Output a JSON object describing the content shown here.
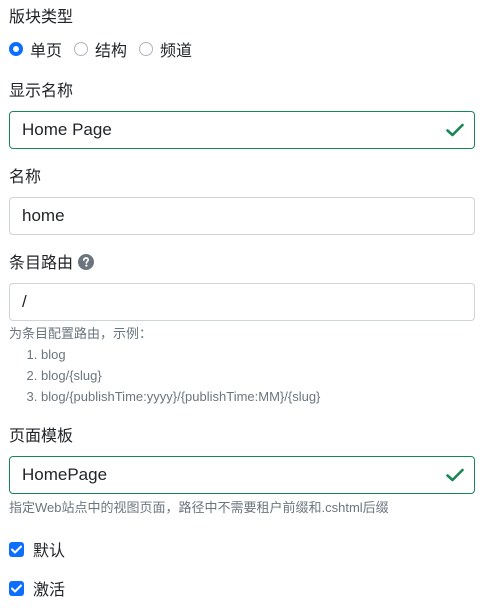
{
  "block_type": {
    "label": "版块类型",
    "options": [
      "单页",
      "结构",
      "频道"
    ],
    "selected": "单页"
  },
  "display_name": {
    "label": "显示名称",
    "value": "Home Page"
  },
  "name": {
    "label": "名称",
    "value": "home"
  },
  "route": {
    "label": "条目路由",
    "value": "/",
    "help_intro": "为条目配置路由，示例：",
    "examples": [
      "blog",
      "blog/{slug}",
      "blog/{publishTime:yyyy}/{publishTime:MM}/{slug}"
    ]
  },
  "page_template": {
    "label": "页面模板",
    "value": "HomePage",
    "help": "指定Web站点中的视图页面，路径中不需要租户前缀和.cshtml后缀"
  },
  "default_checkbox": {
    "label": "默认",
    "checked": true
  },
  "active_checkbox": {
    "label": "激活",
    "checked": true
  },
  "colors": {
    "primary": "#0d6efd",
    "valid": "#198754",
    "muted": "#6c757d"
  }
}
